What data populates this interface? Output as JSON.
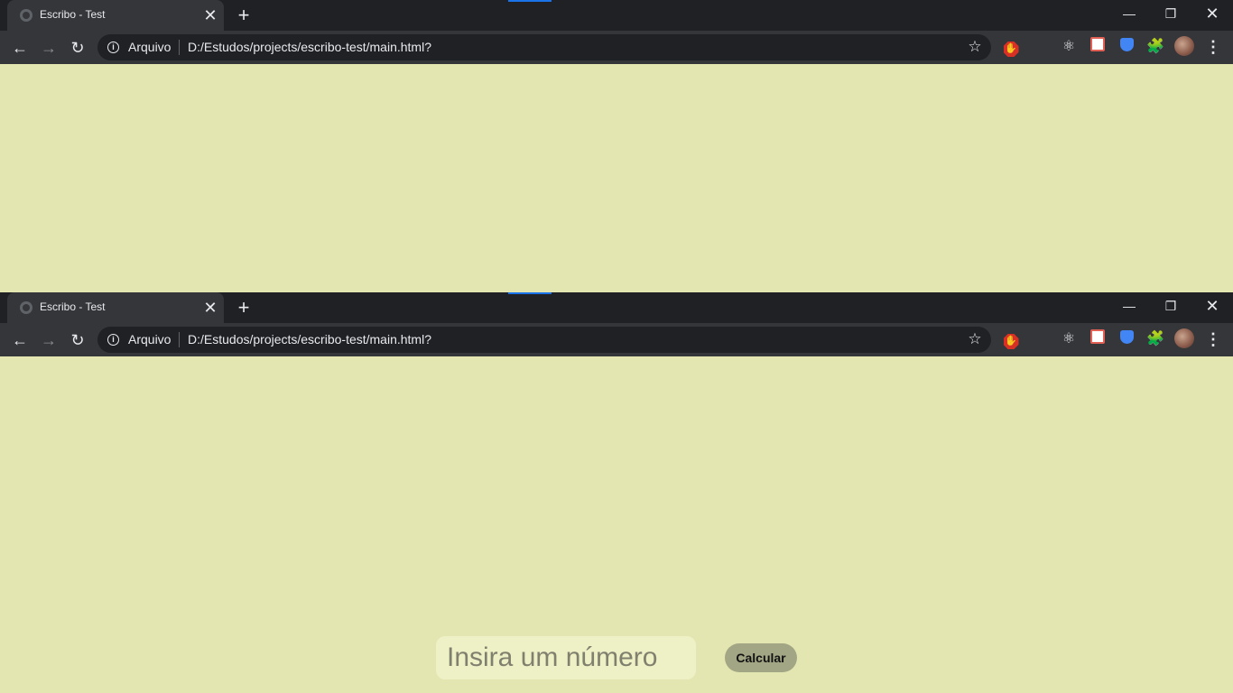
{
  "browser": {
    "tab_title": "Escribo - Test",
    "tab_close": "✕",
    "new_tab": "+",
    "window_controls": {
      "minimize": "—",
      "restore": "❐",
      "close": "✕"
    },
    "nav": {
      "back": "←",
      "forward": "→",
      "reload": "↻"
    },
    "origin_label": "Arquivo",
    "url": "D:/Estudos/projects/escribo-test/main.html?",
    "info_icon": "i",
    "star_icon": "☆",
    "extensions": {
      "react": "⚛",
      "puzzle": "🧩",
      "adblock": "✋"
    },
    "menu_icon": "⋮",
    "accent_color": "#1a73e8",
    "tabstrip_color": "#202124",
    "toolbar_color": "#35363a"
  },
  "page": {
    "background_color": "#e3e6b0",
    "input_placeholder": "Insira um número",
    "calculate_button": "Calcular"
  }
}
